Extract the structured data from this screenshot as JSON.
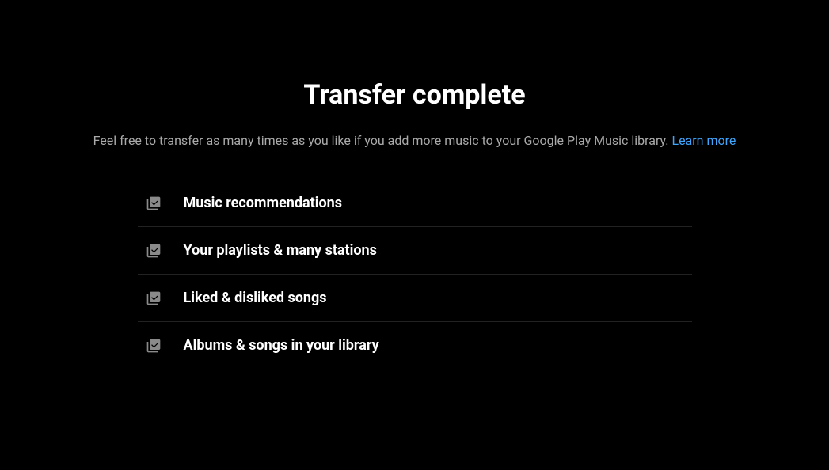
{
  "title": "Transfer complete",
  "subtitle": "Feel free to transfer as many times as you like if you add more music to your Google Play Music library. ",
  "learn_more": "Learn more",
  "items": [
    {
      "label": "Music recommendations"
    },
    {
      "label": "Your playlists & many stations"
    },
    {
      "label": "Liked & disliked songs"
    },
    {
      "label": "Albums & songs in your library"
    }
  ]
}
